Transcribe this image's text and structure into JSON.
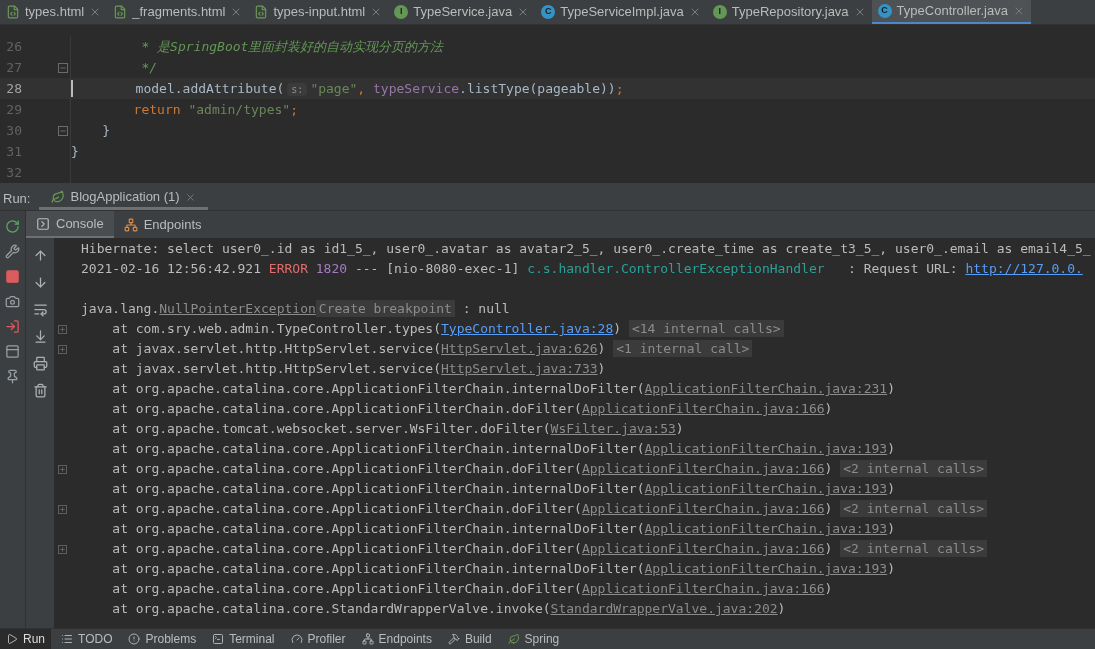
{
  "editor_tabs": [
    {
      "label": "types.html",
      "kind": "html",
      "selected": false
    },
    {
      "label": "_fragments.html",
      "kind": "html",
      "selected": false
    },
    {
      "label": "types-input.html",
      "kind": "html",
      "selected": false
    },
    {
      "label": "TypeService.java",
      "kind": "interface",
      "icon_letter": "I",
      "selected": false
    },
    {
      "label": "TypeServiceImpl.java",
      "kind": "class",
      "icon_letter": "C",
      "selected": false
    },
    {
      "label": "TypeRepository.java",
      "kind": "interface",
      "icon_letter": "I",
      "selected": false
    },
    {
      "label": "TypeController.java",
      "kind": "class",
      "icon_letter": "C",
      "selected": true
    }
  ],
  "code_lines": [
    {
      "number": "26",
      "current": false,
      "fold": false,
      "tokens": [
        {
          "kind": "comment",
          "text": "         * 是SpringBoot里面封装好的自动实现分页的方法"
        }
      ]
    },
    {
      "number": "27",
      "current": false,
      "fold": true,
      "tokens": [
        {
          "kind": "comment",
          "text": "         */"
        }
      ]
    },
    {
      "number": "28",
      "current": true,
      "fold": false,
      "tokens": [
        {
          "kind": "plain",
          "text": "        model.addAttribute("
        },
        {
          "kind": "hint",
          "text": "s:"
        },
        {
          "kind": "string",
          "text": "\"page\""
        },
        {
          "kind": "keyword",
          "text": ", "
        },
        {
          "kind": "field",
          "text": "typeService"
        },
        {
          "kind": "plain",
          "text": ".listType(pageable))"
        },
        {
          "kind": "keyword",
          "text": ";"
        }
      ]
    },
    {
      "number": "29",
      "current": false,
      "fold": false,
      "tokens": [
        {
          "kind": "keyword",
          "text": "        return "
        },
        {
          "kind": "string",
          "text": "\"admin/types\""
        },
        {
          "kind": "keyword",
          "text": ";"
        }
      ]
    },
    {
      "number": "30",
      "current": false,
      "fold": true,
      "tokens": [
        {
          "kind": "plain",
          "text": "    }"
        }
      ]
    },
    {
      "number": "31",
      "current": false,
      "fold": false,
      "tokens": [
        {
          "kind": "plain",
          "text": "}"
        }
      ]
    },
    {
      "number": "32",
      "current": false,
      "fold": false
    }
  ],
  "run_panel": {
    "label": "Run:",
    "tabs": [
      {
        "label": "BlogApplication (1)",
        "selected": true
      }
    ],
    "console_tabs": [
      {
        "label": "Console",
        "kind": "console",
        "selected": true
      },
      {
        "label": "Endpoints",
        "kind": "endpoints",
        "selected": false
      }
    ]
  },
  "console_lines": [
    {
      "foldable": false,
      "tokens": [
        {
          "kind": "plain",
          "text": "Hibernate: select user0_.id as id1_5_, user0_.avatar as avatar2_5_, user0_.create_time as create_t3_5_, user0_.email as email4_5_"
        }
      ]
    },
    {
      "foldable": false,
      "tokens": [
        {
          "kind": "plain",
          "text": "2021-02-16 12:56:42.921 "
        },
        {
          "kind": "error",
          "text": "ERROR"
        },
        {
          "kind": "pid",
          "text": "1820"
        },
        {
          "kind": "plain",
          "text": " --- [nio-8080-exec-1] "
        },
        {
          "kind": "logger",
          "text": "c.s.handler.ControllerExceptionHandler"
        },
        {
          "kind": "plain",
          "text": "   : Request URL: "
        },
        {
          "kind": "url",
          "text": "http://127.0.0."
        }
      ]
    },
    {
      "foldable": false
    },
    {
      "foldable": false,
      "tokens": [
        {
          "kind": "plain",
          "text": "java.lang."
        },
        {
          "kind": "filelink",
          "text": "NullPointerException"
        },
        {
          "kind": "chip",
          "text": "Create breakpoint"
        },
        {
          "kind": "plain",
          "text": " : null"
        }
      ]
    },
    {
      "foldable": true,
      "tokens": [
        {
          "kind": "plain",
          "text": "    at com.sry.web.admin.TypeController.types("
        },
        {
          "kind": "url",
          "text": "TypeController.java:28"
        },
        {
          "kind": "plain",
          "text": ") "
        },
        {
          "kind": "chip",
          "text": "<14 internal calls>"
        }
      ]
    },
    {
      "foldable": true,
      "tokens": [
        {
          "kind": "plain",
          "text": "    at javax.servlet.http.HttpServlet.service("
        },
        {
          "kind": "filelink",
          "text": "HttpServlet.java:626"
        },
        {
          "kind": "plain",
          "text": ") "
        },
        {
          "kind": "chip",
          "text": "<1 internal call>"
        }
      ]
    },
    {
      "foldable": false,
      "tokens": [
        {
          "kind": "plain",
          "text": "    at javax.servlet.http.HttpServlet.service("
        },
        {
          "kind": "filelink",
          "text": "HttpServlet.java:733"
        },
        {
          "kind": "plain",
          "text": ")"
        }
      ]
    },
    {
      "foldable": false,
      "tokens": [
        {
          "kind": "plain",
          "text": "    at org.apache.catalina.core.ApplicationFilterChain.internalDoFilter("
        },
        {
          "kind": "filelink",
          "text": "ApplicationFilterChain.java:231"
        },
        {
          "kind": "plain",
          "text": ")"
        }
      ]
    },
    {
      "foldable": false,
      "tokens": [
        {
          "kind": "plain",
          "text": "    at org.apache.catalina.core.ApplicationFilterChain.doFilter("
        },
        {
          "kind": "filelink",
          "text": "ApplicationFilterChain.java:166"
        },
        {
          "kind": "plain",
          "text": ")"
        }
      ]
    },
    {
      "foldable": false,
      "tokens": [
        {
          "kind": "plain",
          "text": "    at org.apache.tomcat.websocket.server.WsFilter.doFilter("
        },
        {
          "kind": "filelink",
          "text": "WsFilter.java:53"
        },
        {
          "kind": "plain",
          "text": ")"
        }
      ]
    },
    {
      "foldable": false,
      "tokens": [
        {
          "kind": "plain",
          "text": "    at org.apache.catalina.core.ApplicationFilterChain.internalDoFilter("
        },
        {
          "kind": "filelink",
          "text": "ApplicationFilterChain.java:193"
        },
        {
          "kind": "plain",
          "text": ")"
        }
      ]
    },
    {
      "foldable": true,
      "tokens": [
        {
          "kind": "plain",
          "text": "    at org.apache.catalina.core.ApplicationFilterChain.doFilter("
        },
        {
          "kind": "filelink",
          "text": "ApplicationFilterChain.java:166"
        },
        {
          "kind": "plain",
          "text": ") "
        },
        {
          "kind": "chip",
          "text": "<2 internal calls>"
        }
      ]
    },
    {
      "foldable": false,
      "tokens": [
        {
          "kind": "plain",
          "text": "    at org.apache.catalina.core.ApplicationFilterChain.internalDoFilter("
        },
        {
          "kind": "filelink",
          "text": "ApplicationFilterChain.java:193"
        },
        {
          "kind": "plain",
          "text": ")"
        }
      ]
    },
    {
      "foldable": true,
      "tokens": [
        {
          "kind": "plain",
          "text": "    at org.apache.catalina.core.ApplicationFilterChain.doFilter("
        },
        {
          "kind": "filelink",
          "text": "ApplicationFilterChain.java:166"
        },
        {
          "kind": "plain",
          "text": ") "
        },
        {
          "kind": "chip",
          "text": "<2 internal calls>"
        }
      ]
    },
    {
      "foldable": false,
      "tokens": [
        {
          "kind": "plain",
          "text": "    at org.apache.catalina.core.ApplicationFilterChain.internalDoFilter("
        },
        {
          "kind": "filelink",
          "text": "ApplicationFilterChain.java:193"
        },
        {
          "kind": "plain",
          "text": ")"
        }
      ]
    },
    {
      "foldable": true,
      "tokens": [
        {
          "kind": "plain",
          "text": "    at org.apache.catalina.core.ApplicationFilterChain.doFilter("
        },
        {
          "kind": "filelink",
          "text": "ApplicationFilterChain.java:166"
        },
        {
          "kind": "plain",
          "text": ") "
        },
        {
          "kind": "chip",
          "text": "<2 internal calls>"
        }
      ]
    },
    {
      "foldable": false,
      "tokens": [
        {
          "kind": "plain",
          "text": "    at org.apache.catalina.core.ApplicationFilterChain.internalDoFilter("
        },
        {
          "kind": "filelink",
          "text": "ApplicationFilterChain.java:193"
        },
        {
          "kind": "plain",
          "text": ")"
        }
      ]
    },
    {
      "foldable": false,
      "tokens": [
        {
          "kind": "plain",
          "text": "    at org.apache.catalina.core.ApplicationFilterChain.doFilter("
        },
        {
          "kind": "filelink",
          "text": "ApplicationFilterChain.java:166"
        },
        {
          "kind": "plain",
          "text": ")"
        }
      ]
    },
    {
      "foldable": false,
      "tokens": [
        {
          "kind": "plain",
          "text": "    at org.apache.catalina.core.StandardWrapperValve.invoke("
        },
        {
          "kind": "filelink",
          "text": "StandardWrapperValve.java:202"
        },
        {
          "kind": "plain",
          "text": ")"
        }
      ]
    }
  ],
  "tool_windows": [
    {
      "label": "Run",
      "kind": "run",
      "selected": true
    },
    {
      "label": "TODO",
      "kind": "todo",
      "selected": false
    },
    {
      "label": "Problems",
      "kind": "problems",
      "selected": false
    },
    {
      "label": "Terminal",
      "kind": "terminal",
      "selected": false
    },
    {
      "label": "Profiler",
      "kind": "profiler",
      "selected": false
    },
    {
      "label": "Endpoints",
      "kind": "endpoints",
      "selected": false
    },
    {
      "label": "Build",
      "kind": "build",
      "selected": false
    },
    {
      "label": "Spring",
      "kind": "spring",
      "selected": false
    }
  ]
}
